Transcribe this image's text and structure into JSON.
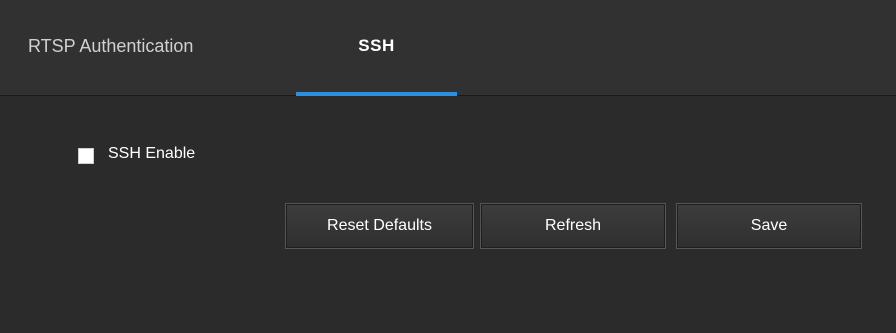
{
  "tabs": [
    {
      "label": "RTSP Authentication",
      "active": false
    },
    {
      "label": "SSH",
      "active": true
    }
  ],
  "ssh_enable": {
    "label": "SSH Enable",
    "checked": false
  },
  "buttons": {
    "reset_defaults": "Reset Defaults",
    "refresh": "Refresh",
    "save": "Save"
  },
  "colors": {
    "background": "#2b2b2b",
    "tab_bar": "#313131",
    "active_tab_underline": "#2d8fe0",
    "text": "#ffffff"
  }
}
